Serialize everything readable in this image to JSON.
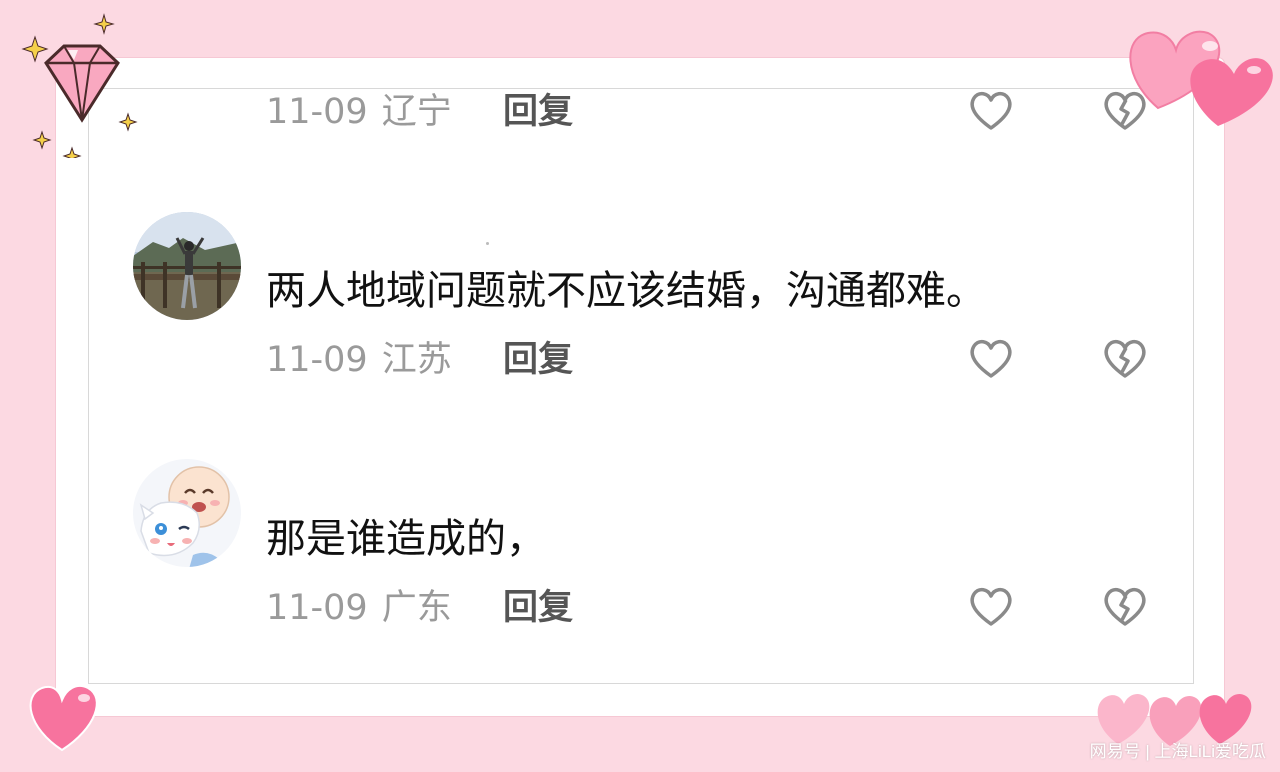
{
  "comments": [
    {
      "text": "",
      "date": "11-09",
      "location": "辽宁",
      "reply": "回复"
    },
    {
      "text": "两人地域问题就不应该结婚，沟通都难。",
      "date": "11-09",
      "location": "江苏",
      "reply": "回复"
    },
    {
      "text": "那是谁造成的，",
      "date": "11-09",
      "location": "广东",
      "reply": "回复"
    }
  ],
  "icons": {
    "like": "heart-outline-icon",
    "dislike": "broken-heart-icon"
  },
  "watermark": "网易号 | 上海LiLi爱吃瓜",
  "colors": {
    "background": "#fcd9e2",
    "heart_pink": "#f7739e",
    "icon_gray": "#8a8a8a"
  }
}
